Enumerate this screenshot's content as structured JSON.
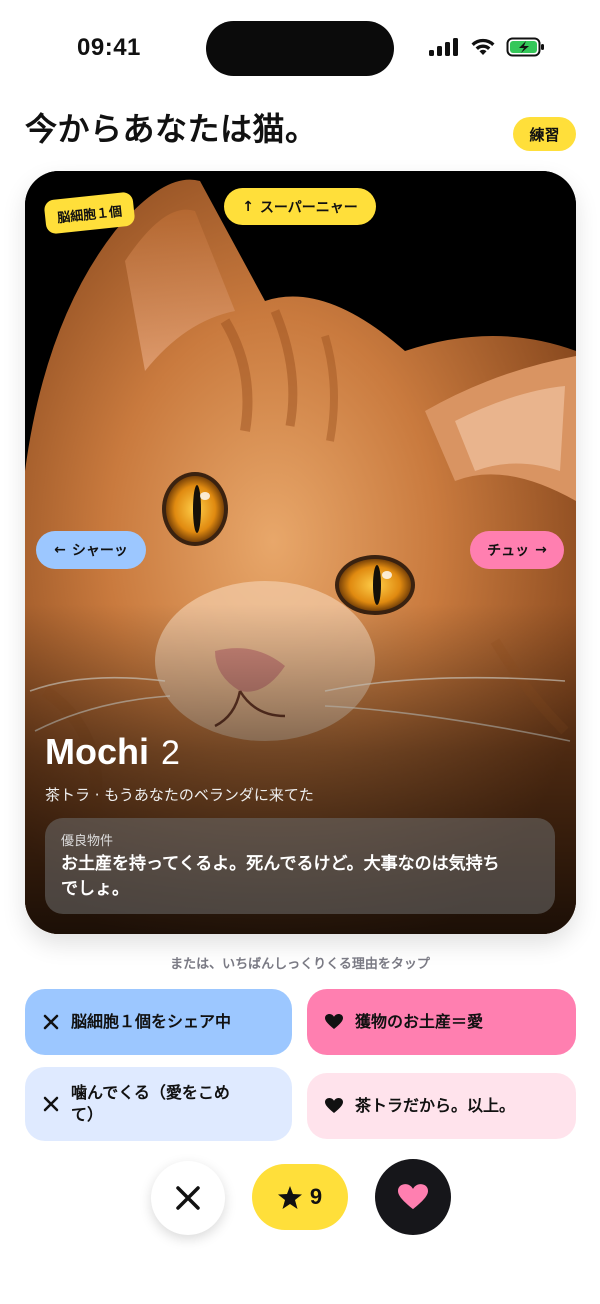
{
  "status_bar": {
    "time": "09:41"
  },
  "header": {
    "title": "今からあなたは猫。",
    "practice_label": "練習"
  },
  "card": {
    "brain_badge": "脳細胞１個",
    "super_chip_label": "スーパーニャー",
    "hiss_chip_label": "シャーッ",
    "kiss_chip_label": "チュッ",
    "name": "Mochi",
    "age": "2",
    "description": "茶トラ · もうあなたのベランダに来てた",
    "property_label": "優良物件",
    "property_text": "お土産を持ってくるよ。死んでるけど。大事なのは気持ちでしょ。"
  },
  "hint": "または、いちばんしっくりくる理由をタップ",
  "reasons": [
    {
      "label": "脳細胞１個をシェア中",
      "icon": "x-icon",
      "color": "#9cc7ff"
    },
    {
      "label": "獲物のお土産＝愛",
      "icon": "heart-icon",
      "color": "#ff7fb0"
    },
    {
      "label": "噛んでくる（愛をこめて）",
      "icon": "x-icon",
      "color": "#dfeaff"
    },
    {
      "label": "茶トラだから。以上。",
      "icon": "heart-icon",
      "color": "#ffe3ec"
    }
  ],
  "actions": {
    "super_like_count": "9"
  },
  "colors": {
    "accent_yellow": "#ffdf3a",
    "accent_blue": "#9cc7ff",
    "accent_pink": "#ff7fb0",
    "dark": "#16161a"
  }
}
